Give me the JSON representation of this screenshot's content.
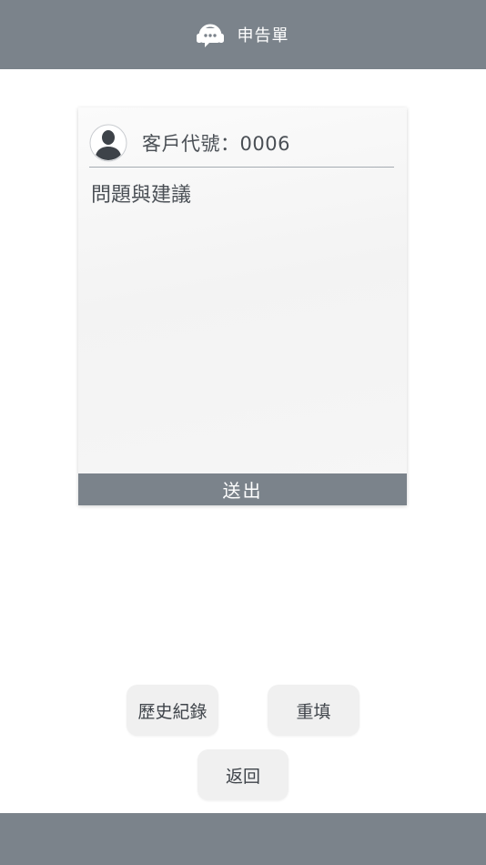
{
  "header": {
    "title": "申告單",
    "icon": "headset-chat-icon"
  },
  "form": {
    "avatar_icon": "user-avatar-icon",
    "customer_label": "客戶代號：0006",
    "message_placeholder": "問題與建議",
    "message_value": "",
    "submit_label": "送出"
  },
  "actions": {
    "history_label": "歷史紀錄",
    "reset_label": "重填",
    "back_label": "返回"
  },
  "colors": {
    "bar": "#7b838b",
    "card": "#f5f5f5",
    "button": "#f0f0f0",
    "text": "#4a4f55"
  }
}
